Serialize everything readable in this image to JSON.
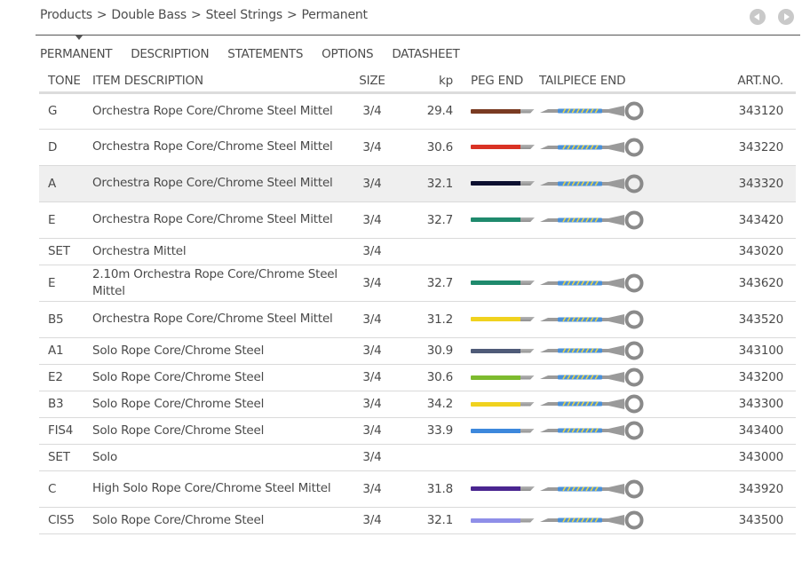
{
  "breadcrumb": [
    "Products",
    "Double Bass",
    "Steel Strings",
    "Permanent"
  ],
  "breadcrumb_separator": ">",
  "pager": {
    "prev_icon": "chevron-left-circle-icon",
    "next_icon": "chevron-right-circle-icon"
  },
  "tabs": [
    {
      "label": "PERMANENT",
      "active": true
    },
    {
      "label": "DESCRIPTION",
      "active": false
    },
    {
      "label": "STATEMENTS",
      "active": false
    },
    {
      "label": "OPTIONS",
      "active": false
    },
    {
      "label": "DATASHEET",
      "active": false
    }
  ],
  "table": {
    "headers": {
      "tone": "TONE",
      "description": "ITEM DESCRIPTION",
      "size": "SIZE",
      "kp": "kp",
      "peg_end": "PEG END",
      "tailpiece_end": "TAILPIECE END",
      "art_no": "ART.NO."
    },
    "colors": {
      "tailpiece_metal": "#9a9a9a",
      "tailpiece_wrap_blue": "#4a90d9",
      "tailpiece_wrap_yellow": "#e6d24a",
      "row_highlight": "#efefef"
    },
    "rows": [
      {
        "tone": "G",
        "description": "Orchestra Rope Core/Chrome Steel Mittel",
        "size": "3/4",
        "kp": "29.4",
        "peg_color": "#7a3b22",
        "tailpiece": true,
        "art_no": "343120",
        "highlight": false
      },
      {
        "tone": "D",
        "description": "Orchestra Rope Core/Chrome Steel Mittel",
        "size": "3/4",
        "kp": "30.6",
        "peg_color": "#d93224",
        "tailpiece": true,
        "art_no": "343220",
        "highlight": false
      },
      {
        "tone": "A",
        "description": "Orchestra Rope Core/Chrome Steel Mittel",
        "size": "3/4",
        "kp": "32.1",
        "peg_color": "#0d1030",
        "tailpiece": true,
        "art_no": "343320",
        "highlight": true
      },
      {
        "tone": "E",
        "description": "Orchestra Rope Core/Chrome Steel Mittel",
        "size": "3/4",
        "kp": "32.7",
        "peg_color": "#1f8a6d",
        "tailpiece": true,
        "art_no": "343420",
        "highlight": false
      },
      {
        "tone": "SET",
        "description": "Orchestra Mittel",
        "size": "3/4",
        "kp": "",
        "peg_color": "",
        "tailpiece": false,
        "art_no": "343020",
        "highlight": false
      },
      {
        "tone": "E",
        "description": "2.10m Orchestra Rope Core/Chrome Steel Mittel",
        "size": "3/4",
        "kp": "32.7",
        "peg_color": "#1f8a6d",
        "tailpiece": true,
        "art_no": "343620",
        "highlight": false
      },
      {
        "tone": "B5",
        "description": "Orchestra Rope Core/Chrome Steel Mittel",
        "size": "3/4",
        "kp": "31.2",
        "peg_color": "#f0d21e",
        "tailpiece": true,
        "art_no": "343520",
        "highlight": false
      },
      {
        "tone": "A1",
        "description": "Solo Rope Core/Chrome Steel",
        "size": "3/4",
        "kp": "30.9",
        "peg_color": "#4f5b78",
        "tailpiece": true,
        "art_no": "343100",
        "highlight": false
      },
      {
        "tone": "E2",
        "description": "Solo Rope Core/Chrome Steel",
        "size": "3/4",
        "kp": "30.6",
        "peg_color": "#7dbb2e",
        "tailpiece": true,
        "art_no": "343200",
        "highlight": false
      },
      {
        "tone": "B3",
        "description": "Solo Rope Core/Chrome Steel",
        "size": "3/4",
        "kp": "34.2",
        "peg_color": "#f0d21e",
        "tailpiece": true,
        "art_no": "343300",
        "highlight": false
      },
      {
        "tone": "FIS4",
        "description": "Solo Rope Core/Chrome Steel",
        "size": "3/4",
        "kp": "33.9",
        "peg_color": "#3d88dc",
        "tailpiece": true,
        "art_no": "343400",
        "highlight": false
      },
      {
        "tone": "SET",
        "description": "Solo",
        "size": "3/4",
        "kp": "",
        "peg_color": "",
        "tailpiece": false,
        "art_no": "343000",
        "highlight": false
      },
      {
        "tone": "C",
        "description": "High Solo Rope Core/Chrome Steel Mittel",
        "size": "3/4",
        "kp": "31.8",
        "peg_color": "#4a2690",
        "tailpiece": true,
        "art_no": "343920",
        "highlight": false
      },
      {
        "tone": "CIS5",
        "description": "Solo Rope Core/Chrome Steel",
        "size": "3/4",
        "kp": "32.1",
        "peg_color": "#8f8fe8",
        "tailpiece": true,
        "art_no": "343500",
        "highlight": false
      }
    ]
  }
}
